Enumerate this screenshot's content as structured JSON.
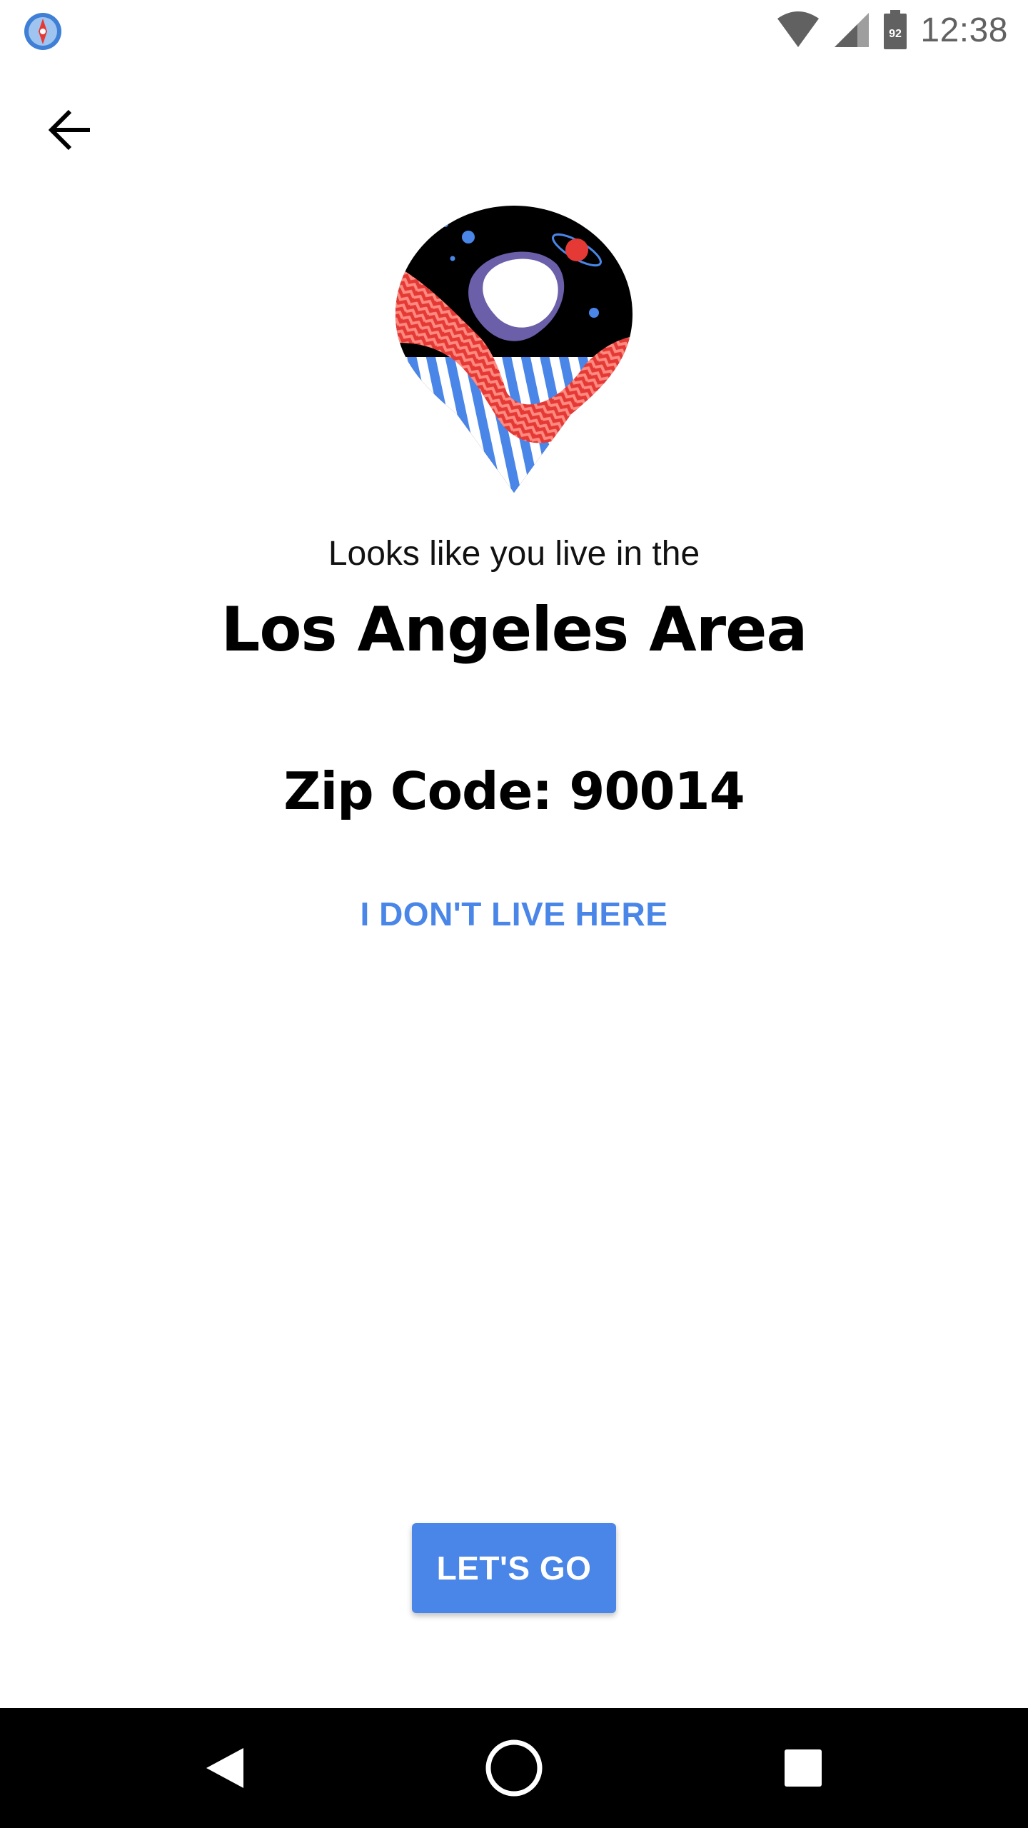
{
  "status_bar": {
    "time": "12:38",
    "battery_level": "92",
    "icons": [
      "app-notification-icon",
      "wifi-icon",
      "cell-signal-icon",
      "battery-icon"
    ]
  },
  "header": {
    "back_icon": "arrow-left-icon"
  },
  "main": {
    "illustration_icon": "location-pin-illustration",
    "subtitle": "Looks like you live in the",
    "area_name": "Los Angeles Area",
    "zip_code_text": "Zip Code: 90014",
    "not_here_link": "I DON'T LIVE HERE",
    "primary_button": "LET'S GO"
  },
  "nav_bar": {
    "icons": [
      "nav-back-icon",
      "nav-home-icon",
      "nav-recents-icon"
    ]
  },
  "colors": {
    "accent": "#4a86e8",
    "text_primary": "#000000",
    "status_gray": "#616161",
    "nav_background": "#000000",
    "pin_red": "#e53935",
    "pin_blue": "#4a86e8",
    "pin_purple": "#6a5fa8"
  }
}
